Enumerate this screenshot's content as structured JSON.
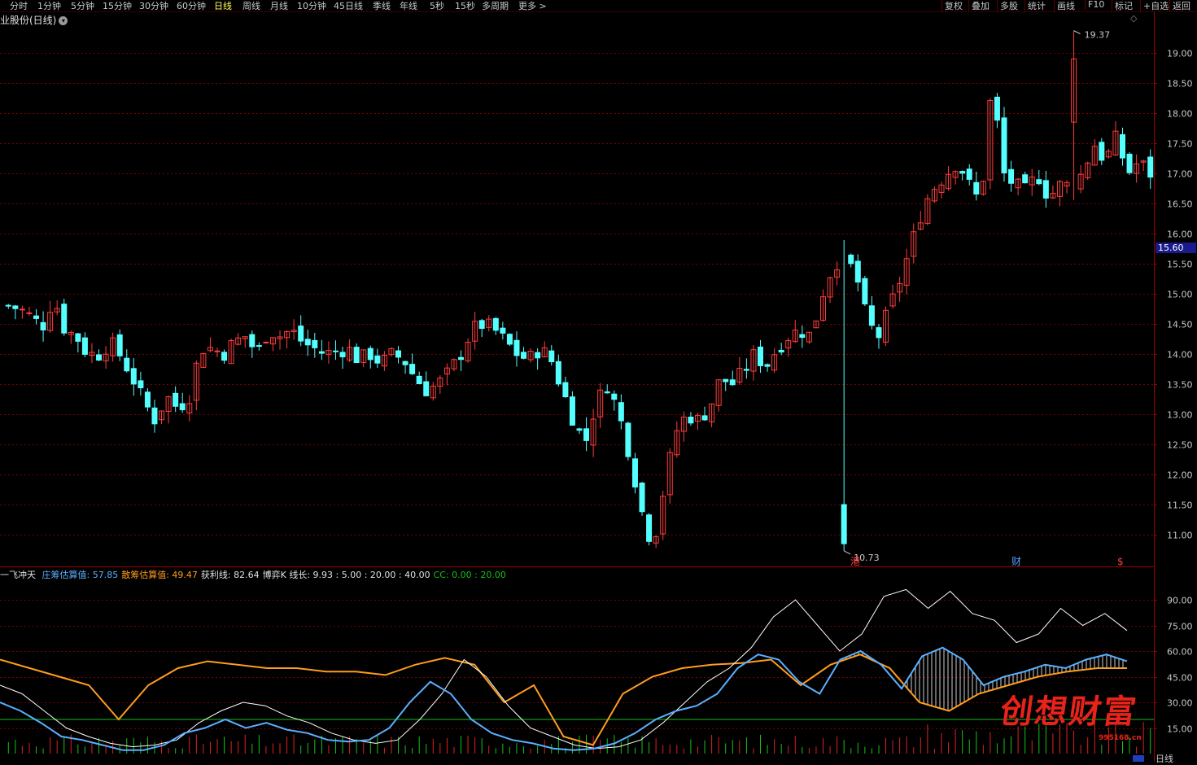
{
  "toolbar": {
    "periods": [
      "分时",
      "1分钟",
      "5分钟",
      "15分钟",
      "30分钟",
      "60分钟",
      "日线",
      "周线",
      "月线",
      "10分钟",
      "45日线",
      "季线",
      "年线",
      "5秒",
      "15秒",
      "多周期",
      "更多 >"
    ],
    "active_period": "日线",
    "tools": [
      "复权",
      "叠加",
      "多股",
      "统计",
      "画线",
      "F10",
      "标记",
      "+自选",
      "返回"
    ]
  },
  "title": {
    "stock": "业股份(日线)"
  },
  "colors": {
    "up": "#ff3c3c",
    "down": "#54ffff",
    "grid": "#7a0000",
    "orange": "#ff9d1e",
    "blue": "#5ab0ff",
    "white": "#ffffff",
    "green": "#19c019",
    "bg": "#000000"
  },
  "chart_data": [
    {
      "type": "candlestick",
      "title": "业股份(日线)",
      "y_ticks": [
        "19.00",
        "18.50",
        "18.00",
        "17.50",
        "17.00",
        "16.50",
        "16.00",
        "15.50",
        "15.00",
        "14.50",
        "14.00",
        "13.50",
        "13.00",
        "12.50",
        "12.00",
        "11.50",
        "11.00"
      ],
      "ylim": [
        10.5,
        19.5
      ],
      "annotations": {
        "high": "19.37",
        "low": "10.73",
        "last_price": "15.60"
      },
      "event_markers": [
        {
          "label": "港"
        },
        {
          "label": "财"
        },
        {
          "label": "$"
        }
      ],
      "close_anchors": [
        14.8,
        14.75,
        14.62,
        14.45,
        14.95,
        14.4,
        14.3,
        14.0,
        14.0,
        14.2,
        13.95,
        13.6,
        13.2,
        12.9,
        13.3,
        13.1,
        13.3,
        14.1,
        14.1,
        14.0,
        14.2,
        14.3,
        14.0,
        14.4,
        14.3,
        14.4,
        14.2,
        14.1,
        14.0,
        14.05,
        14.1,
        13.9,
        14.0,
        13.85,
        14.0,
        13.9,
        13.6,
        13.4,
        13.5,
        13.7,
        14.0,
        14.4,
        14.5,
        14.4,
        14.2,
        14.0,
        13.9,
        14.1,
        13.9,
        13.4,
        12.9,
        12.5,
        13.2,
        13.5,
        13.0,
        12.3,
        11.4,
        10.8,
        11.8,
        12.7,
        13.0,
        12.9,
        13.1,
        13.6,
        13.5,
        13.7,
        14.0,
        13.8,
        14.1,
        14.3,
        14.4,
        14.3,
        15.0,
        15.5,
        15.6,
        15.3,
        14.5,
        14.3,
        14.8,
        15.3,
        15.9,
        16.5,
        16.8,
        17.0,
        17.2,
        16.8,
        16.5,
        18.5,
        17.0,
        16.8,
        16.7,
        17.0,
        16.6,
        16.8,
        16.8,
        17.0,
        17.5,
        17.2,
        17.6,
        17.0,
        17.2,
        17.0
      ]
    },
    {
      "type": "line",
      "indicator_name": "一飞冲天",
      "legend": [
        {
          "label": "庄筹估算值:",
          "value": "57.85",
          "color": "#5ab0ff"
        },
        {
          "label": "散筹估算值:",
          "value": "49.47",
          "color": "#ff9d1e"
        },
        {
          "label": "获利线:",
          "value": "82.64",
          "color": "#e0e0e0"
        },
        {
          "label": "博弈K 线长:",
          "value": "9.93 : 5.00 : 20.00 : 40.00",
          "color": "#e0e0e0"
        },
        {
          "label": "CC:",
          "value": "0.00 : 20.00",
          "color": "#19c019"
        }
      ],
      "y_ticks": [
        "90.00",
        "75.00",
        "60.00",
        "45.00",
        "30.00",
        "15.00"
      ],
      "ylim": [
        0,
        100
      ],
      "reference_line": 20,
      "series": [
        {
          "name": "庄筹估算值",
          "values": [
            30,
            25,
            18,
            10,
            8,
            5,
            2,
            2,
            5,
            12,
            15,
            20,
            15,
            18,
            14,
            12,
            8,
            7,
            8,
            15,
            30,
            42,
            35,
            20,
            12,
            8,
            6,
            3,
            2,
            3,
            6,
            12,
            20,
            25,
            28,
            35,
            50,
            58,
            55,
            42,
            35,
            55,
            60,
            52,
            38,
            57,
            62,
            55,
            40,
            45,
            48,
            52,
            50,
            55,
            58,
            54
          ]
        },
        {
          "name": "散筹估算值",
          "values": [
            55,
            50,
            45,
            40,
            20,
            40,
            50,
            54,
            52,
            50,
            50,
            48,
            48,
            46,
            52,
            56,
            52,
            30,
            40,
            10,
            5,
            35,
            45,
            50,
            52,
            53,
            55,
            40,
            52,
            58,
            50,
            30,
            25,
            35,
            40,
            45,
            48,
            50,
            50
          ]
        },
        {
          "name": "获利线",
          "values": [
            40,
            35,
            25,
            15,
            10,
            6,
            4,
            5,
            8,
            18,
            25,
            30,
            28,
            22,
            18,
            12,
            8,
            6,
            8,
            20,
            35,
            55,
            45,
            28,
            15,
            10,
            5,
            3,
            4,
            8,
            18,
            30,
            42,
            50,
            62,
            80,
            90,
            75,
            60,
            70,
            92,
            96,
            85,
            95,
            82,
            78,
            65,
            70,
            85,
            75,
            82,
            72
          ]
        }
      ]
    }
  ],
  "watermark": {
    "text": "创想财富",
    "url": "995168.cn"
  },
  "footer": {
    "period_label": "日线"
  }
}
